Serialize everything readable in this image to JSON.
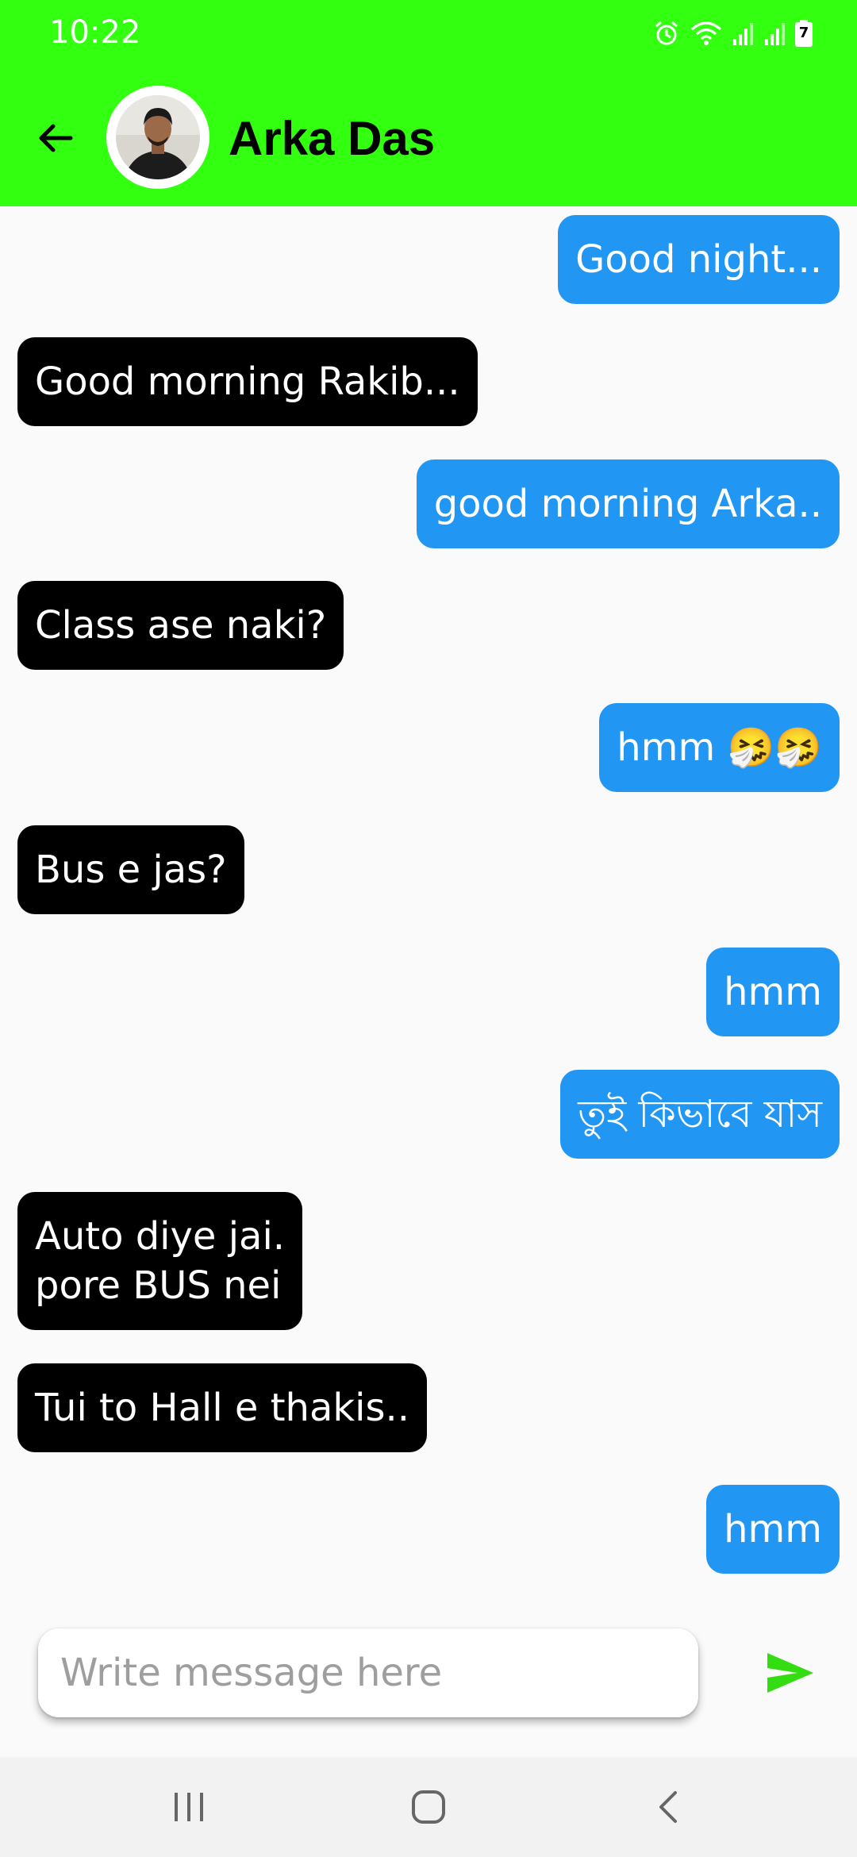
{
  "status_bar": {
    "time": "10:22",
    "battery_level": "7"
  },
  "header": {
    "contact_name": "Arka Das",
    "avatar_icon": "person-avatar",
    "back_icon": "arrow-left-icon",
    "bar_color": "#33ff11"
  },
  "messages": [
    {
      "from": "me",
      "text": "Good night..."
    },
    {
      "from": "them",
      "text": "Good morning Rakib..."
    },
    {
      "from": "me",
      "text": "good morning Arka.."
    },
    {
      "from": "them",
      "text": "Class ase naki?"
    },
    {
      "from": "me",
      "text": "hmm 🤧🤧"
    },
    {
      "from": "them",
      "text": "Bus e jas?"
    },
    {
      "from": "me",
      "text": "hmm"
    },
    {
      "from": "me",
      "text": "তুই কিভাবে যাস"
    },
    {
      "from": "them",
      "text": "Auto diye jai.\npore BUS nei"
    },
    {
      "from": "them",
      "text": "Tui to Hall e thakis.."
    },
    {
      "from": "me",
      "text": "hmm"
    }
  ],
  "colors": {
    "my_bubble": "#2196f3",
    "their_bubble": "#000000",
    "send_icon": "#33dd11"
  },
  "composer": {
    "placeholder": "Write message here",
    "value": "",
    "send_icon": "send-icon"
  },
  "nav": {
    "recents_icon": "recents-icon",
    "home_icon": "home-icon",
    "back_icon": "back-chevron-icon"
  }
}
